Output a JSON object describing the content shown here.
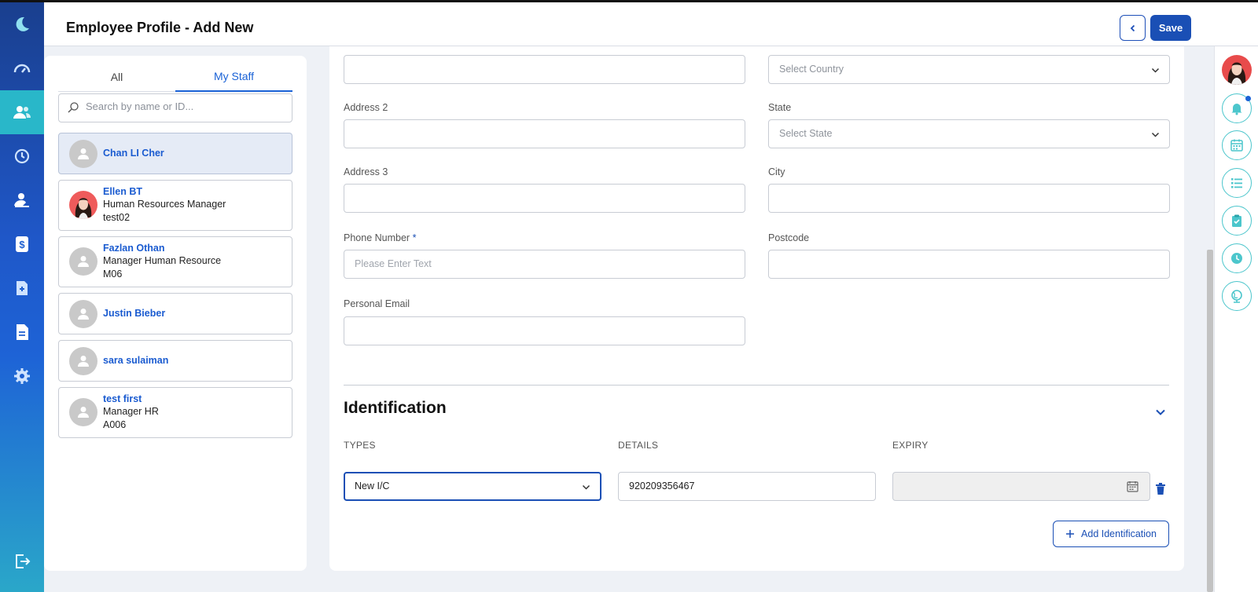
{
  "header": {
    "title": "Employee Profile - Add New",
    "save_label": "Save"
  },
  "staff": {
    "tabs": [
      "All",
      "My Staff"
    ],
    "search_placeholder": "Search by name or ID...",
    "items": [
      {
        "name": "Chan LI Cher",
        "title": "",
        "id": ""
      },
      {
        "name": "Ellen BT",
        "title": "Human Resources Manager",
        "id": "test02"
      },
      {
        "name": "Fazlan Othan",
        "title": "Manager Human Resource",
        "id": "M06"
      },
      {
        "name": "Justin Bieber",
        "title": "",
        "id": ""
      },
      {
        "name": "sara sulaiman",
        "title": "",
        "id": ""
      },
      {
        "name": "test first",
        "title": "Manager HR",
        "id": "A006"
      }
    ]
  },
  "form": {
    "address1_value": "",
    "country": {
      "placeholder": "Select Country"
    },
    "address2": {
      "label": "Address 2",
      "value": ""
    },
    "state": {
      "label": "State",
      "placeholder": "Select State"
    },
    "address3": {
      "label": "Address 3",
      "value": ""
    },
    "city": {
      "label": "City",
      "value": ""
    },
    "phone": {
      "label": "Phone Number",
      "required_mark": "*",
      "placeholder": "Please Enter Text",
      "value": ""
    },
    "postcode": {
      "label": "Postcode",
      "value": ""
    },
    "personal_email": {
      "label": "Personal Email",
      "value": ""
    }
  },
  "identification": {
    "title": "Identification",
    "columns": [
      "TYPES",
      "DETAILS",
      "EXPIRY"
    ],
    "row": {
      "type": "New I/C",
      "details": "920209356467",
      "expiry": ""
    },
    "add_label": "Add Identification"
  },
  "colors": {
    "primary": "#1a4fb5",
    "accent": "#29b7c9",
    "link": "#1a62d6"
  }
}
